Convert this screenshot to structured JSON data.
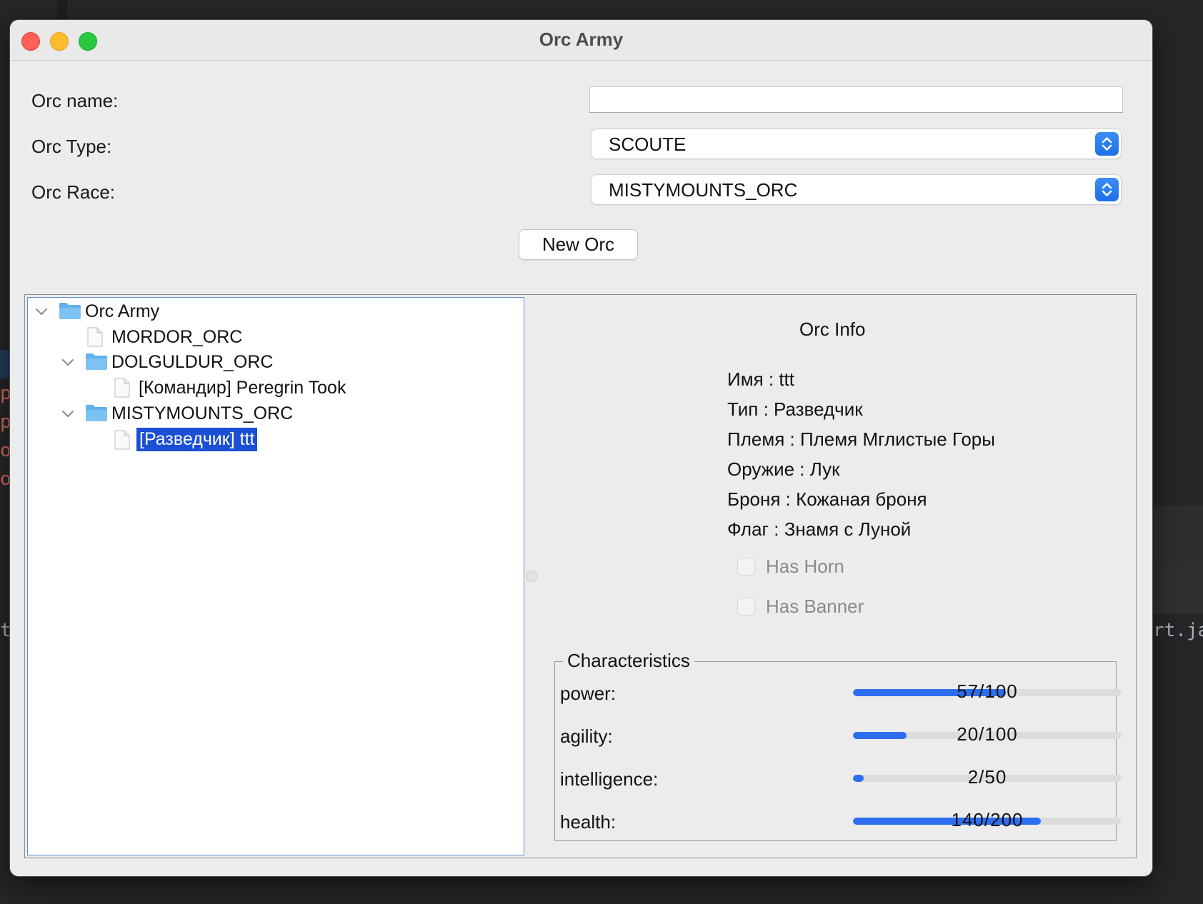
{
  "window": {
    "title": "Orc Army"
  },
  "form": {
    "name_label": "Orc name:",
    "name_value": "",
    "type_label": "Orc Type:",
    "type_value": "SCOUTE",
    "race_label": "Orc Race:",
    "race_value": "MISTYMOUNTS_ORC",
    "new_button": "New Orc"
  },
  "tree": {
    "root": "Orc Army",
    "nodes": [
      "MORDOR_ORC",
      "DOLGULDUR_ORC",
      "[Командир] Peregrin Took",
      "MISTYMOUNTS_ORC",
      "[Разведчик] ttt"
    ]
  },
  "info": {
    "title": "Orc Info",
    "lines": [
      "Имя : ttt",
      "Тип : Разведчик",
      "Племя : Племя Мглистые Горы",
      "Оружие : Лук",
      "Броня : Кожаная броня",
      "Флаг : Знамя с Луной"
    ],
    "has_horn": "Has Horn",
    "has_banner": "Has Banner"
  },
  "characteristics": {
    "legend": "Characteristics",
    "stats": [
      {
        "label": "power:",
        "text": "57/100",
        "value": 57,
        "max": 100
      },
      {
        "label": "agility:",
        "text": "20/100",
        "value": 20,
        "max": 100
      },
      {
        "label": "intelligence:",
        "text": "2/50",
        "value": 2,
        "max": 50
      },
      {
        "label": "health:",
        "text": "140/200",
        "value": 140,
        "max": 200
      }
    ]
  },
  "background": {
    "left_marks": [
      "p",
      "p",
      "o",
      "o"
    ],
    "left_code": "tu",
    "right_code": "rt.ja"
  },
  "colors": {
    "accent": "#2d6ef0",
    "selection": "#1a4fd6",
    "progress_track": "#dcdcdc"
  }
}
